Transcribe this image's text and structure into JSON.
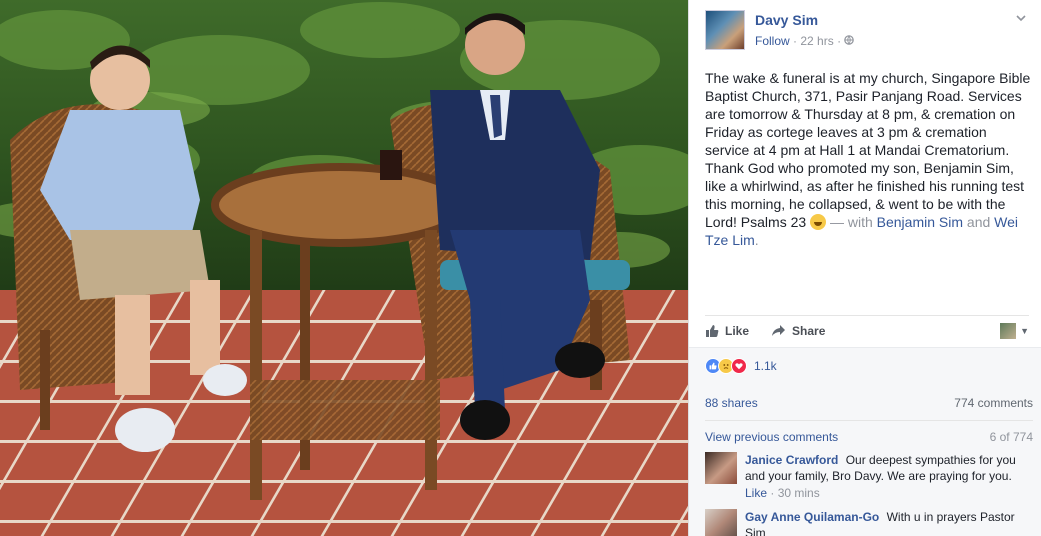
{
  "photo": {
    "alt": "Father and son seated in rattan chairs beside a wicker table"
  },
  "post": {
    "author": "Davy Sim",
    "follow": "Follow",
    "time": "22 hrs",
    "text_main": "The wake & funeral is at my church, Singapore Bible Baptist Church, 371, Pasir Panjang Road. Services are tomorrow & Thursday at 8 pm, & cremation on Friday as cortege leaves at 3 pm & cremation service at 4 pm at Hall 1 at Mandai Crematorium. Thank God who promoted my son, Benjamin Sim, like a whirlwind, as after he finished his running test this morning, he collapsed, & went to be with the Lord! Psalms 23",
    "with_text": "— with",
    "tag1": "Benjamin Sim",
    "and_text": "and",
    "tag2": "Wei Tze Lim",
    "period": "."
  },
  "actions": {
    "like": "Like",
    "share": "Share"
  },
  "stats": {
    "reactions_count": "1.1k",
    "shares": "88 shares",
    "comments": "774 comments"
  },
  "comments_section": {
    "view_previous": "View previous comments",
    "position": "6 of 774",
    "items": [
      {
        "name": "Janice Crawford",
        "text": "Our deepest sympathies for you and your family, Bro Davy. We are praying for you.",
        "like": "Like",
        "time": "30 mins"
      },
      {
        "name": "Gay Anne Quilaman-Go",
        "text": "With u in prayers Pastor Sim"
      }
    ]
  },
  "colors": {
    "link": "#365899",
    "text": "#1d2129",
    "muted": "#90949c"
  }
}
